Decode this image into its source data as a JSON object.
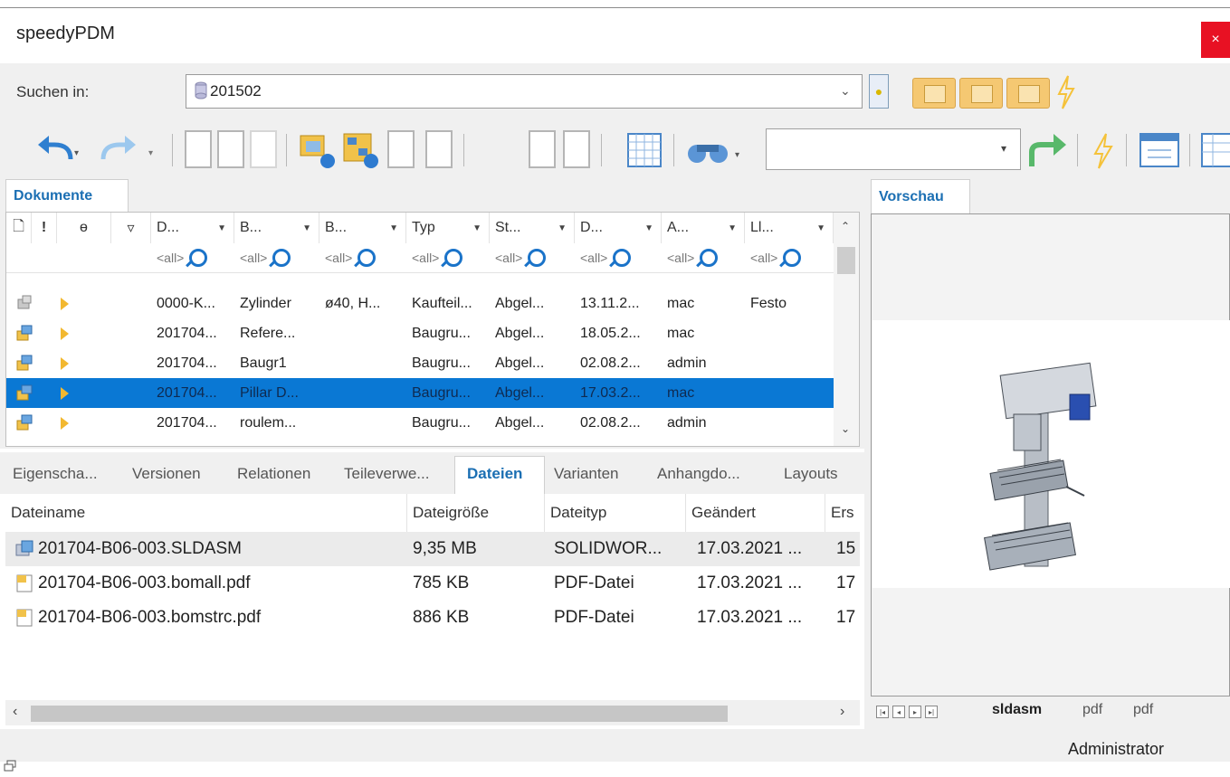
{
  "window": {
    "title": "speedyPDM",
    "close_label": "×"
  },
  "search": {
    "label": "Suchen in:",
    "value": "201502"
  },
  "documents_panel": {
    "tab_label": "Dokumente",
    "header_icons": [
      "document-icon",
      "exclamation-icon",
      "attachment-icon",
      "flag-icon"
    ],
    "columns": [
      "D...",
      "B...",
      "B...",
      "Typ",
      "St...",
      "D...",
      "A...",
      "Ll..."
    ],
    "filter_value": "<all>",
    "rows": [
      {
        "icon": "part-grey-icon",
        "number": "0000-K...",
        "desc1": "Zylinder",
        "desc2": "ø40, H...",
        "type": "Kaufteil...",
        "status": "Abgel...",
        "date": "13.11.2...",
        "author": "mac",
        "supplier": "Festo"
      },
      {
        "icon": "assembly-icon",
        "number": "201704...",
        "desc1": "Refere...",
        "desc2": "",
        "type": "Baugru...",
        "status": "Abgel...",
        "date": "18.05.2...",
        "author": "mac",
        "supplier": ""
      },
      {
        "icon": "assembly-icon",
        "number": "201704...",
        "desc1": "Baugr1",
        "desc2": "",
        "type": "Baugru...",
        "status": "Abgel...",
        "date": "02.08.2...",
        "author": "admin",
        "supplier": ""
      },
      {
        "icon": "assembly-icon",
        "number": "201704...",
        "desc1": "Pillar D...",
        "desc2": "",
        "type": "Baugru...",
        "status": "Abgel...",
        "date": "17.03.2...",
        "author": "mac",
        "supplier": "",
        "selected": true
      },
      {
        "icon": "assembly-icon",
        "number": "201704...",
        "desc1": "roulem...",
        "desc2": "",
        "type": "Baugru...",
        "status": "Abgel...",
        "date": "02.08.2...",
        "author": "admin",
        "supplier": ""
      }
    ]
  },
  "detail_tabs": [
    "Eigenscha...",
    "Versionen",
    "Relationen",
    "Teileverwe...",
    "Dateien",
    "Varianten",
    "Anhangdo...",
    "Layouts"
  ],
  "active_detail_tab": "Dateien",
  "files": {
    "columns": [
      "Dateiname",
      "Dateigröße",
      "Dateityp",
      "Geändert",
      "Ers"
    ],
    "rows": [
      {
        "icon": "assembly-file-icon",
        "name": "201704-B06-003.SLDASM",
        "size": "9,35 MB",
        "type": "SOLIDWOR...",
        "changed": "17.03.2021 ...",
        "created": "15"
      },
      {
        "icon": "pdf-file-icon",
        "name": "201704-B06-003.bomall.pdf",
        "size": "785 KB",
        "type": "PDF-Datei",
        "changed": "17.03.2021 ...",
        "created": "17"
      },
      {
        "icon": "pdf-file-icon",
        "name": "201704-B06-003.bomstrc.pdf",
        "size": "886 KB",
        "type": "PDF-Datei",
        "changed": "17.03.2021 ...",
        "created": "17"
      }
    ]
  },
  "preview": {
    "tab_label": "Vorschau",
    "tabs": [
      "sldasm",
      "pdf",
      "pdf"
    ],
    "active_tab": "sldasm"
  },
  "status_bar": {
    "user": "Administrator"
  },
  "colors": {
    "selection": "#0a78d4",
    "accent_tab_text": "#1b6fb3",
    "close_button": "#e81123",
    "folder": "#f5c872"
  }
}
